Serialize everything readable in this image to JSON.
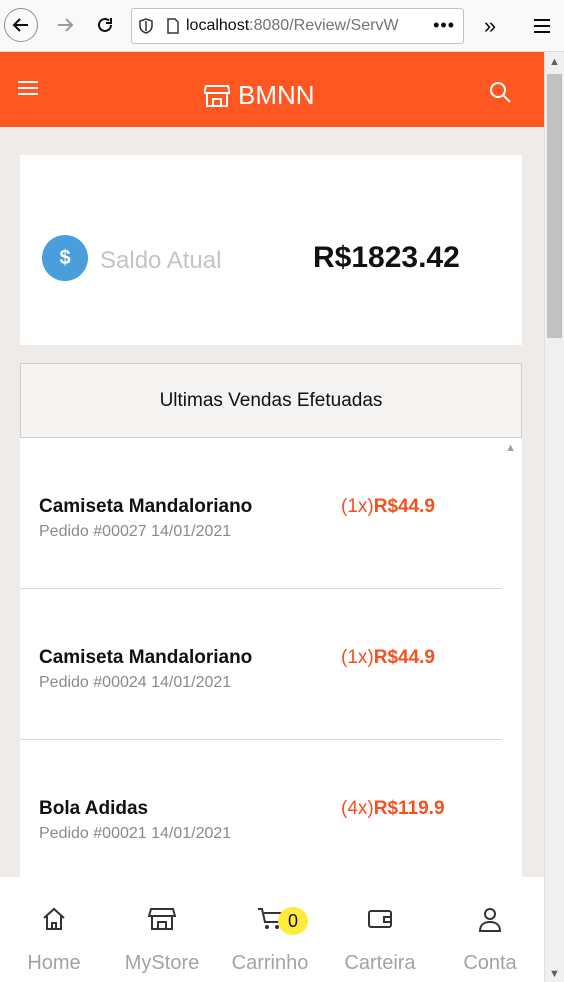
{
  "browser": {
    "url_host": "localhost",
    "url_rest": ":8080/Review/ServW",
    "more_label": "•••",
    "overflow_label": "»"
  },
  "app": {
    "brand": "BMNN",
    "accent_color": "#ff5722"
  },
  "balance": {
    "label": "Saldo Atual",
    "value": "R$1823.42",
    "icon_symbol": "$"
  },
  "sales": {
    "header": "Ultimas Vendas Efetuadas",
    "items": [
      {
        "name": "Camiseta Mandaloriano",
        "meta": "Pedido #00027 14/01/2021",
        "qty": "(1x)",
        "price": "R$44.9"
      },
      {
        "name": "Camiseta Mandaloriano",
        "meta": "Pedido #00024 14/01/2021",
        "qty": "(1x)",
        "price": "R$44.9"
      },
      {
        "name": "Bola Adidas",
        "meta": "Pedido #00021 14/01/2021",
        "qty": "(4x)",
        "price": "R$119.9"
      }
    ]
  },
  "bottom_nav": {
    "items": [
      {
        "label": "Home",
        "icon": "home-icon"
      },
      {
        "label": "MyStore",
        "icon": "store-icon"
      },
      {
        "label": "Carrinho",
        "icon": "cart-icon"
      },
      {
        "label": "Carteira",
        "icon": "wallet-icon"
      },
      {
        "label": "Conta",
        "icon": "user-icon"
      }
    ],
    "cart_count": "0"
  }
}
